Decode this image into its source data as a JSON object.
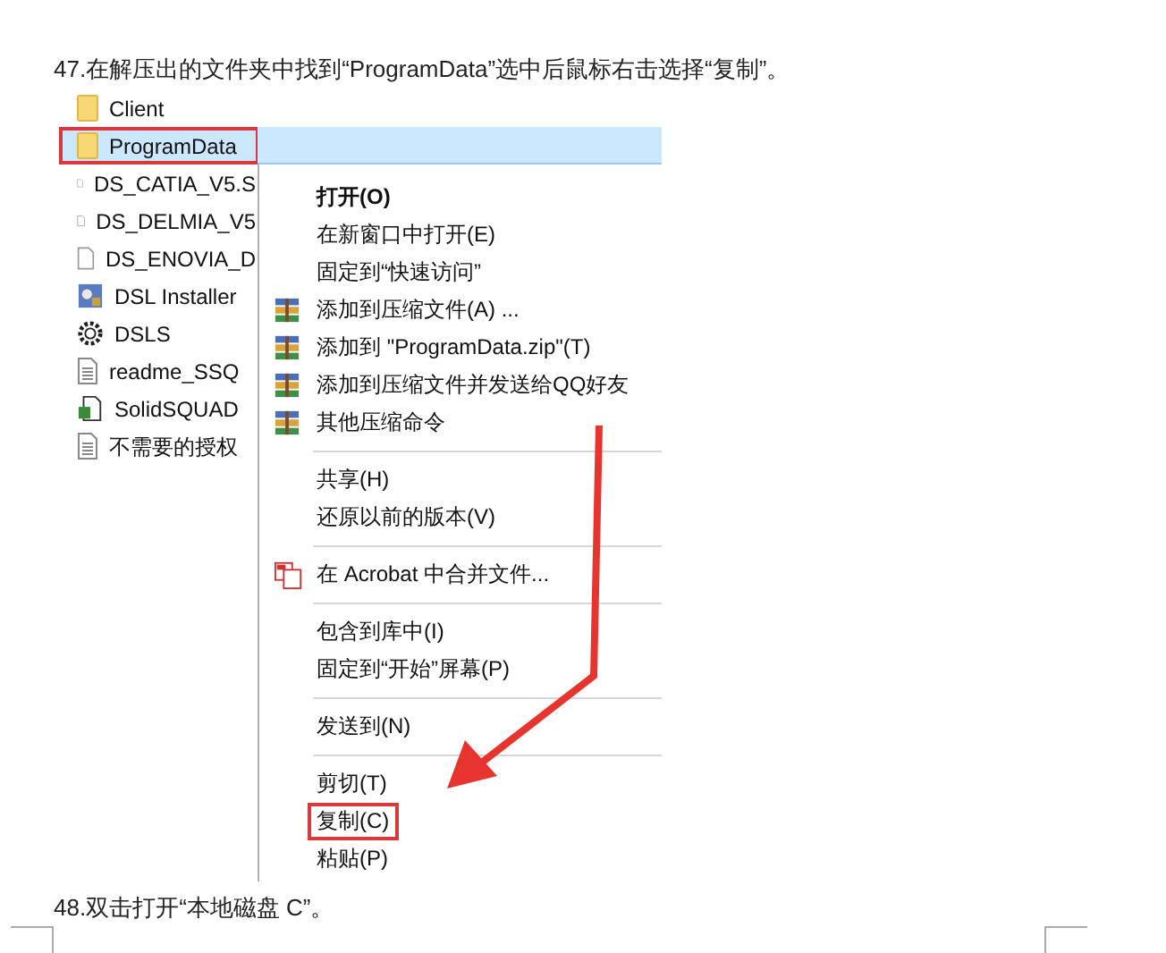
{
  "steps": [
    {
      "text": "47.在解压出的文件夹中找到“ProgramData”选中后鼠标右击选择“复制”。"
    }
  ],
  "files": [
    {
      "name": "Client",
      "kind": "folder",
      "selected": false,
      "boxed": false
    },
    {
      "name": "ProgramData",
      "kind": "folder",
      "selected": true,
      "boxed": true
    },
    {
      "name": "DS_CATIA_V5.S",
      "kind": "file",
      "selected": false,
      "boxed": false
    },
    {
      "name": "DS_DELMIA_V5",
      "kind": "file",
      "selected": false,
      "boxed": false
    },
    {
      "name": "DS_ENOVIA_D",
      "kind": "file",
      "selected": false,
      "boxed": false
    },
    {
      "name": "DSL Installer",
      "kind": "installer",
      "selected": false,
      "boxed": false
    },
    {
      "name": "DSLS",
      "kind": "gear",
      "selected": false,
      "boxed": false
    },
    {
      "name": "readme_SSQ",
      "kind": "text",
      "selected": false,
      "boxed": false
    },
    {
      "name": "SolidSQUAD",
      "kind": "shortcut",
      "selected": false,
      "boxed": false
    },
    {
      "name": "不需要的授权",
      "kind": "text",
      "selected": false,
      "boxed": false
    }
  ],
  "context_menu": [
    {
      "kind": "plain",
      "label": "打开(O)",
      "bold": true,
      "boxed": false
    },
    {
      "kind": "plain",
      "label": "在新窗口中打开(E)",
      "bold": false,
      "boxed": false
    },
    {
      "kind": "plain",
      "label": "固定到“快速访问”",
      "bold": false,
      "boxed": false
    },
    {
      "kind": "archive",
      "label": "添加到压缩文件(A) ...",
      "bold": false,
      "boxed": false
    },
    {
      "kind": "archive",
      "label": "添加到 \"ProgramData.zip\"(T)",
      "bold": false,
      "boxed": false
    },
    {
      "kind": "archive",
      "label": "添加到压缩文件并发送给QQ好友",
      "bold": false,
      "boxed": false
    },
    {
      "kind": "archive",
      "label": "其他压缩命令",
      "bold": false,
      "boxed": false
    },
    {
      "kind": "separator"
    },
    {
      "kind": "plain",
      "label": "共享(H)",
      "bold": false,
      "boxed": false
    },
    {
      "kind": "plain",
      "label": "还原以前的版本(V)",
      "bold": false,
      "boxed": false
    },
    {
      "kind": "separator"
    },
    {
      "kind": "acrobat",
      "label": "在 Acrobat 中合并文件...",
      "bold": false,
      "boxed": false
    },
    {
      "kind": "separator"
    },
    {
      "kind": "plain",
      "label": "包含到库中(I)",
      "bold": false,
      "boxed": false
    },
    {
      "kind": "plain",
      "label": "固定到“开始”屏幕(P)",
      "bold": false,
      "boxed": false
    },
    {
      "kind": "separator"
    },
    {
      "kind": "plain",
      "label": "发送到(N)",
      "bold": false,
      "boxed": false
    },
    {
      "kind": "separator"
    },
    {
      "kind": "plain",
      "label": "剪切(T)",
      "bold": false,
      "boxed": false
    },
    {
      "kind": "plain",
      "label": "复制(C)",
      "bold": false,
      "boxed": true
    },
    {
      "kind": "plain",
      "label": "粘贴(P)",
      "bold": false,
      "boxed": false
    }
  ],
  "next_step": {
    "text": "48.双击打开“本地磁盘 C”。"
  }
}
